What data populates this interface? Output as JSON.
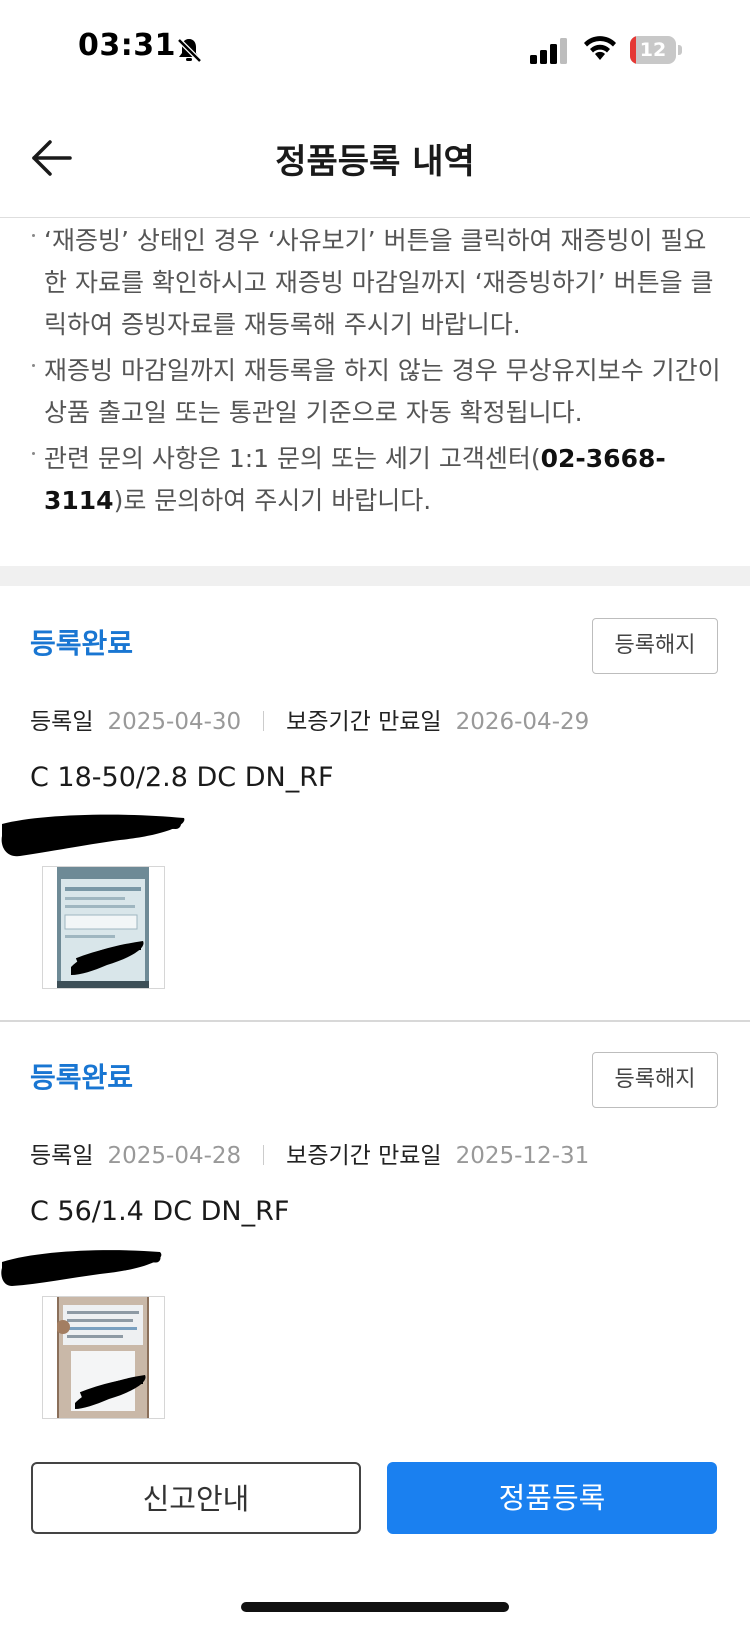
{
  "status_bar": {
    "time": "03:31",
    "battery_level": "12",
    "battery_fraction": 0.12,
    "icons": [
      "bell-slash-icon",
      "signal-icon",
      "wifi-icon",
      "battery-icon"
    ]
  },
  "header": {
    "back_icon": "arrow-left-icon",
    "title": "정품등록 내역"
  },
  "notice": {
    "items": [
      {
        "text": "‘재증빙’ 상태인 경우 ‘사유보기’ 버튼을 클릭하여 재증빙이 필요한 자료를 확인하시고 재증빙 마감일까지 ‘재증빙하기’ 버튼을 클릭하여 증빙자료를 재등록해 주시기 바랍니다."
      },
      {
        "text": "재증빙 마감일까지 재등록을 하지 않는 경우 무상유지보수 기간이 상품 출고일 또는 통관일 기준으로 자동 확정됩니다."
      },
      {
        "text_before": "관련 문의 사항은 1:1 문의 또는 세기 고객센터(",
        "phone": "02-3668-3114",
        "text_after": ")로 문의하여 주시기 바랍니다."
      }
    ]
  },
  "registrations": [
    {
      "status": "등록완료",
      "cancel_label": "등록해지",
      "reg_date_label": "등록일",
      "reg_date": "2025-04-30",
      "expiry_label": "보증기간 만료일",
      "expiry_date": "2026-04-29",
      "product": "C 18-50/2.8 DC DN_RF"
    },
    {
      "status": "등록완료",
      "cancel_label": "등록해지",
      "reg_date_label": "등록일",
      "reg_date": "2025-04-28",
      "expiry_label": "보증기간 만료일",
      "expiry_date": "2025-12-31",
      "product": "C 56/1.4 DC DN_RF"
    }
  ],
  "bottom_buttons": {
    "report_label": "신고안내",
    "register_label": "정품등록"
  },
  "colors": {
    "accent": "#1a80f0",
    "status_blue": "#1976d2",
    "battery_red": "#e53935"
  }
}
